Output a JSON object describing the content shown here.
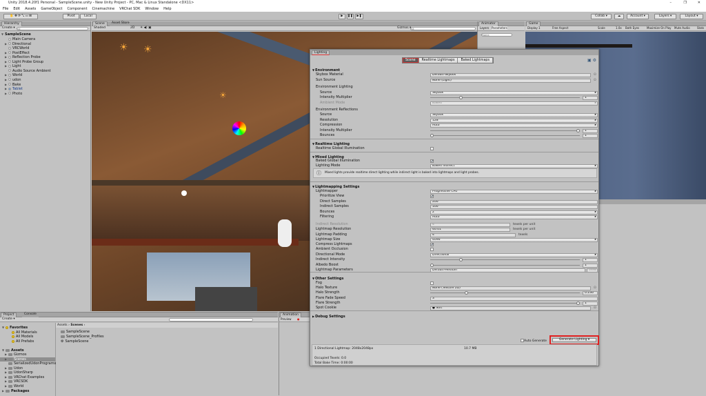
{
  "window": {
    "title": "Unity 2018.4.20f1 Personal - SampleScene.unity - New Unity Project - PC, Mac & Linux Standalone <DX11>",
    "min": "–",
    "max": "❐",
    "close": "✕"
  },
  "menu": [
    "File",
    "Edit",
    "Assets",
    "GameObject",
    "Component",
    "Cinemachine",
    "VRChat SDK",
    "Window",
    "Help"
  ],
  "toolbar": {
    "pivot": "Pivot",
    "local": "Local",
    "play": "▶",
    "pause": "❚❚",
    "step": "▶❚",
    "collab": "Collab ▾",
    "account": "Account ▾",
    "layers": "Layers ▾",
    "layout": "Layout ▾"
  },
  "hierarchy": {
    "tab": "Hierarchy",
    "create": "Create ▾",
    "search_placeholder": "All",
    "scene": "SampleScene",
    "items": [
      {
        "label": "Main Camera",
        "arrow": false
      },
      {
        "label": "Directional",
        "arrow": true
      },
      {
        "label": "VRCWorld",
        "arrow": false
      },
      {
        "label": "PostEffect",
        "arrow": true
      },
      {
        "label": "Reflection Probe",
        "arrow": true
      },
      {
        "label": "Light Probe Group",
        "arrow": true
      },
      {
        "label": "Light",
        "arrow": true
      },
      {
        "label": "Audio Source Ambient",
        "arrow": false
      },
      {
        "label": "World",
        "arrow": true
      },
      {
        "label": "udon",
        "arrow": true
      },
      {
        "label": "Bake",
        "arrow": true
      },
      {
        "label": "Tablet",
        "arrow": true,
        "prefab": true
      },
      {
        "label": "Photo",
        "arrow": true
      }
    ]
  },
  "scene": {
    "tab": "Scene",
    "asset_store": "Asset Store",
    "shading": "Shaded",
    "mode2d": "2D",
    "gizmos": "Gizmos ▾",
    "search_placeholder": "All"
  },
  "animator": {
    "tab": "Animator",
    "layers": "Layers",
    "parameters": "Parameters",
    "search_placeholder": "Name"
  },
  "game": {
    "tab": "Game",
    "display": "Display 1",
    "aspect": "Free Aspect",
    "scale_label": "Scale",
    "scale": "1.0x",
    "eyes": "Both Eyes",
    "maximize": "Maximize On Play",
    "mute": "Mute Audio",
    "stats": "Stats"
  },
  "lighting": {
    "tab": "Lighting",
    "tabs": [
      "Scene",
      "Realtime Lightmaps",
      "Baked Lightmaps"
    ],
    "active_tab": "Scene",
    "rows": [
      {
        "t": "hdr",
        "label": "Environment"
      },
      {
        "t": "obj",
        "label": "Skybox Material",
        "value": "Default-Skybox",
        "i": 1
      },
      {
        "t": "obj",
        "label": "Sun Source",
        "value": "None (Light)",
        "i": 1
      },
      {
        "t": "text",
        "label": "Environment Lighting",
        "i": 1
      },
      {
        "t": "dd",
        "label": "Source",
        "value": "Skybox",
        "i": 2
      },
      {
        "t": "slider",
        "label": "Intensity Multiplier",
        "value": "1",
        "frac": 0.2,
        "i": 2
      },
      {
        "t": "dd",
        "label": "Ambient Mode",
        "value": "Baked",
        "i": 2,
        "dis": true
      },
      {
        "t": "text",
        "label": "Environment Reflections",
        "i": 1
      },
      {
        "t": "dd",
        "label": "Source",
        "value": "Skybox",
        "i": 2
      },
      {
        "t": "dd",
        "label": "Resolution",
        "value": "128",
        "i": 2
      },
      {
        "t": "dd",
        "label": "Compression",
        "value": "Auto",
        "i": 2
      },
      {
        "t": "slider",
        "label": "Intensity Multiplier",
        "value": "1",
        "frac": 1,
        "i": 2
      },
      {
        "t": "slider",
        "label": "Bounces",
        "value": "1",
        "frac": 0,
        "i": 2
      },
      {
        "t": "hdr",
        "label": "Realtime Lighting"
      },
      {
        "t": "chk",
        "label": "Realtime Global Illumination",
        "checked": false,
        "i": 1
      },
      {
        "t": "hdr",
        "label": "Mixed Lighting"
      },
      {
        "t": "chk",
        "label": "Baked Global Illumination",
        "checked": true,
        "i": 1
      },
      {
        "t": "dd",
        "label": "Lighting Mode",
        "value": "Baked Indirect",
        "i": 1
      },
      {
        "t": "info",
        "label": "Mixed lights provide realtime direct lighting while indirect light is baked into lightmaps and light probes."
      },
      {
        "t": "hdr",
        "label": "Lightmapping Settings"
      },
      {
        "t": "dd",
        "label": "Lightmapper",
        "value": "Progressive CPU",
        "i": 1
      },
      {
        "t": "chk",
        "label": "Prioritize View",
        "checked": true,
        "i": 2
      },
      {
        "t": "num",
        "label": "Direct Samples",
        "value": "200",
        "i": 2
      },
      {
        "t": "num",
        "label": "Indirect Samples",
        "value": "100",
        "i": 2
      },
      {
        "t": "dd",
        "label": "Bounces",
        "value": "2",
        "i": 2
      },
      {
        "t": "dd",
        "label": "Filtering",
        "value": "Auto",
        "i": 2
      },
      {
        "t": "unit",
        "label": "Indirect Resolution",
        "value": "4",
        "unit": "texels per unit",
        "i": 1,
        "dis": true
      },
      {
        "t": "unit",
        "label": "Lightmap Resolution",
        "value": "40.01",
        "unit": "texels per unit",
        "i": 1
      },
      {
        "t": "unit2",
        "label": "Lightmap Padding",
        "value": "4",
        "unit": "texels",
        "i": 1
      },
      {
        "t": "dd",
        "label": "Lightmap Size",
        "value": "4096",
        "i": 1
      },
      {
        "t": "chk",
        "label": "Compress Lightmaps",
        "checked": true,
        "i": 1
      },
      {
        "t": "chk",
        "label": "Ambient Occlusion",
        "checked": false,
        "i": 1
      },
      {
        "t": "dd",
        "label": "Directional Mode",
        "value": "Directional",
        "i": 1
      },
      {
        "t": "slider",
        "label": "Indirect Intensity",
        "value": "1",
        "frac": 0.2,
        "i": 1
      },
      {
        "t": "slider",
        "label": "Albedo Boost",
        "value": "1",
        "frac": 0,
        "i": 1
      },
      {
        "t": "ddview",
        "label": "Lightmap Parameters",
        "value": "Default-Medium",
        "button": "View",
        "i": 1
      },
      {
        "t": "hdr",
        "label": "Other Settings"
      },
      {
        "t": "chk",
        "label": "Fog",
        "checked": false,
        "i": 1
      },
      {
        "t": "obj",
        "label": "Halo Texture",
        "value": "None (Texture 2D)",
        "i": 1
      },
      {
        "t": "slider",
        "label": "Halo Strength",
        "value": "0.236",
        "frac": 0.236,
        "i": 1
      },
      {
        "t": "num",
        "label": "Flare Fade Speed",
        "value": "3",
        "i": 1
      },
      {
        "t": "slider",
        "label": "Flare Strength",
        "value": "1",
        "frac": 1,
        "i": 1
      },
      {
        "t": "obj",
        "label": "Spot Cookie",
        "value": "● Soft",
        "i": 1
      },
      {
        "t": "hdrc",
        "label": "Debug Settings"
      }
    ],
    "auto_generate": "Auto Generate",
    "auto_generate_checked": false,
    "generate": "Generate Lighting",
    "stats": {
      "lightmaps": "1 Directional Lightmap: 2048x2048px",
      "size": "10.7 MB",
      "texels": "Occupied Texels: 0.0",
      "bake_time": "Total Bake Time: 0:00:00"
    },
    "highlight_color": "#e02020"
  },
  "project": {
    "tab": "Project",
    "console": "Console",
    "create": "Create ▾",
    "tree": [
      {
        "label": "Favorites",
        "kind": "hdr-fav"
      },
      {
        "label": "All Materials",
        "kind": "fav"
      },
      {
        "label": "All Models",
        "kind": "fav"
      },
      {
        "label": "All Prefabs",
        "kind": "fav"
      },
      {
        "label": "Assets",
        "kind": "hdr"
      },
      {
        "label": "Gizmos",
        "kind": "folder"
      },
      {
        "label": "Scenes",
        "kind": "folder",
        "selected": true
      },
      {
        "label": "SerializedUdonPrograms",
        "kind": "folder-noarrow"
      },
      {
        "label": "Udon",
        "kind": "folder"
      },
      {
        "label": "UdonSharp",
        "kind": "folder"
      },
      {
        "label": "VRChat Examples",
        "kind": "folder"
      },
      {
        "label": "VRCSDK",
        "kind": "folder"
      },
      {
        "label": "World",
        "kind": "folder"
      },
      {
        "label": "Packages",
        "kind": "hdr-c"
      }
    ],
    "breadcrumb": [
      "Assets",
      "Scenes"
    ],
    "files": [
      {
        "label": "SampleScene",
        "kind": "folder"
      },
      {
        "label": "SampleScene_Profiles",
        "kind": "folder"
      },
      {
        "label": "SampleScene",
        "kind": "scene"
      }
    ]
  },
  "animation": {
    "tab": "Animation",
    "preview": "Preview"
  }
}
